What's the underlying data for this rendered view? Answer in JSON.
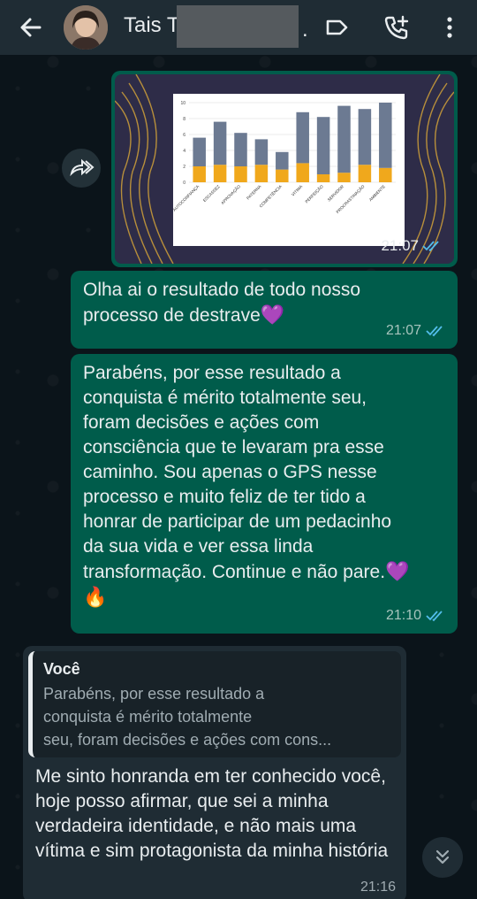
{
  "header": {
    "contact_name": "Tais T",
    "trailing_dot": "."
  },
  "image_message": {
    "time": "21:07",
    "chart_data": {
      "type": "bar",
      "categories": [
        "AUTOCONFIANÇA",
        "ESCASSEZ",
        "APROVAÇÃO",
        "PATERNA",
        "COMPETÊNCIA",
        "VITIMA",
        "PERFEIÇÃO",
        "SERVIDOR",
        "PROCRASTINAÇÃO",
        "AMBIENTE"
      ],
      "series": [
        {
          "values": [
            2,
            2.2,
            2,
            2.2,
            1.6,
            2.4,
            1,
            1.2,
            2.2,
            1.8
          ]
        },
        {
          "values": [
            3.6,
            5.4,
            4.2,
            3.2,
            2.2,
            6.4,
            7.2,
            8.4,
            7,
            8.2
          ]
        }
      ],
      "stacked": true,
      "ylim": [
        0,
        10
      ],
      "yticks": [
        "0",
        "2",
        "4",
        "6",
        "8",
        "10"
      ],
      "colors": [
        "#f0a81c",
        "#6c7a92"
      ],
      "grid": true
    }
  },
  "messages": [
    {
      "text": "Olha ai o resultado de todo nosso processo de destrave",
      "emoji": "💜",
      "time": "21:07"
    },
    {
      "text": "Parabéns, por esse resultado a conquista é mérito totalmente seu, foram decisões e ações com consciência que te levaram pra esse caminho. Sou apenas o GPS nesse processo e muito feliz de ter tido a honrar de participar de um pedacinho da sua vida e ver essa linda transformação. Continue e não pare.",
      "emoji": "💜 🔥",
      "time": "21:10"
    }
  ],
  "incoming": {
    "quote_author": "Você",
    "quote_lines": [
      "Parabéns, por esse resultado a",
      "conquista é mérito totalmente",
      "seu, foram decisões e ações com cons..."
    ],
    "text": "Me sinto honranda em ter conhecido você, hoje posso afirmar, que sei a minha verdadeira identidade, e não mais uma vítima e sim protagonista da minha história",
    "time": "21:16"
  },
  "colors": {
    "outgoing_bubble": "#005c4b",
    "incoming_bubble": "#1f2c34",
    "read_ticks": "#53bdeb"
  }
}
